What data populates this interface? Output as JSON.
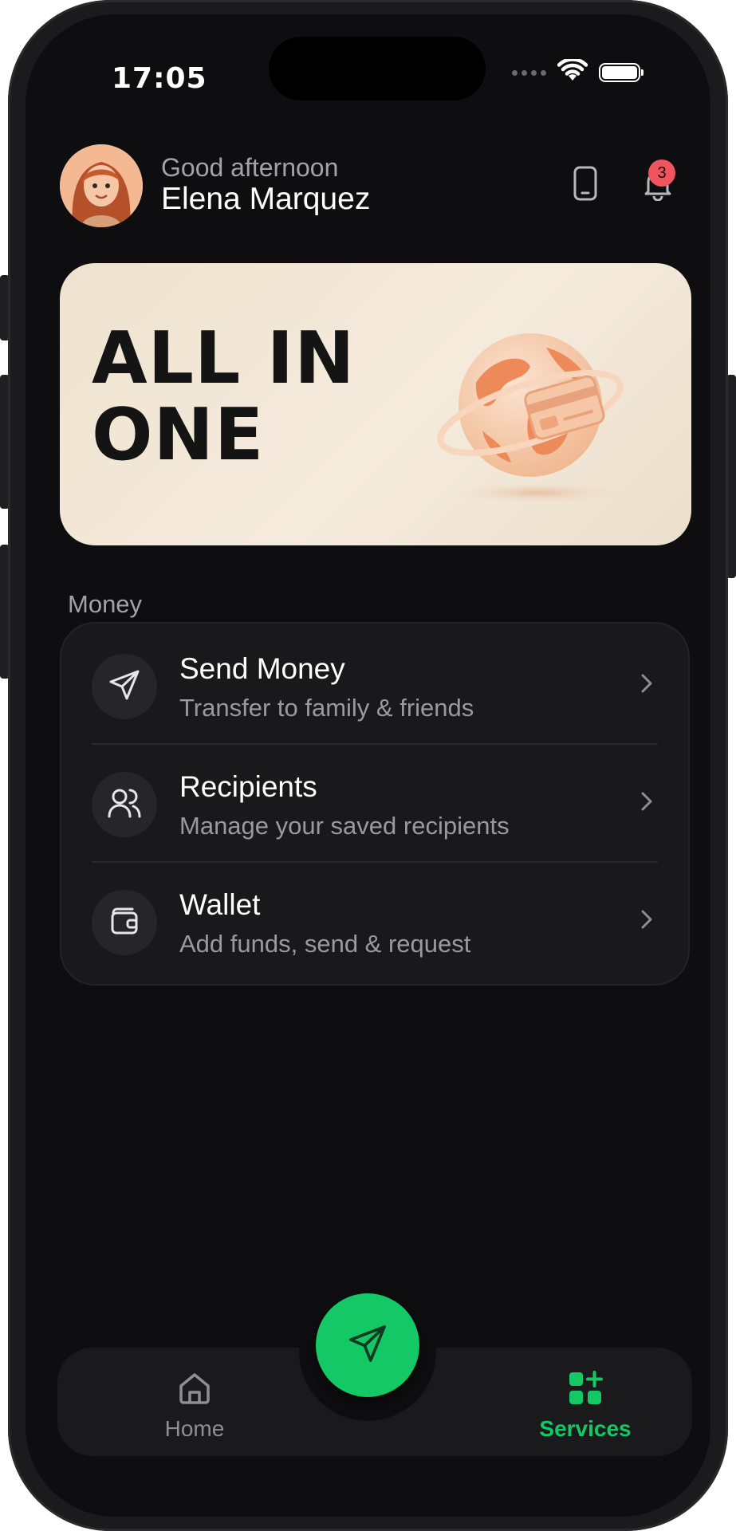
{
  "status_bar": {
    "time": "17:05"
  },
  "header": {
    "greeting": "Good afternoon",
    "user_name": "Elena Marquez",
    "notification_count": "3"
  },
  "banner": {
    "title": "ALL IN\nONE"
  },
  "money_section": {
    "title": "Money",
    "items": [
      {
        "title": "Send Money",
        "subtitle": "Transfer to family & friends",
        "icon": "send-icon"
      },
      {
        "title": "Recipients",
        "subtitle": "Manage your saved recipients",
        "icon": "users-icon"
      },
      {
        "title": "Wallet",
        "subtitle": "Add funds, send & request",
        "icon": "wallet-icon"
      }
    ]
  },
  "bottom_nav": {
    "items": [
      {
        "label": "Home",
        "icon": "home-icon",
        "active": false
      },
      {
        "label": "Services",
        "icon": "services-icon",
        "active": true
      }
    ],
    "fab_icon": "send-icon"
  },
  "colors": {
    "accent": "#14c866",
    "badge": "#f0545e",
    "background": "#0e0e10",
    "card": "#19191b",
    "banner": "#f1e5d4"
  }
}
